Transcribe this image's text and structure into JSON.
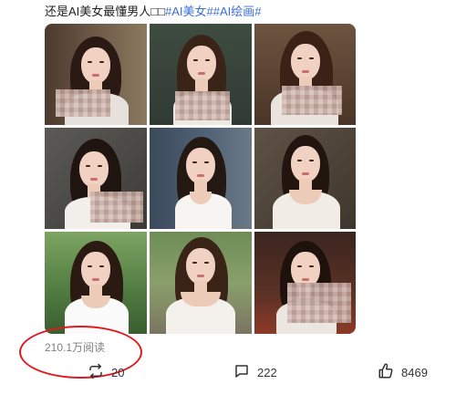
{
  "post": {
    "text": "还是AI美女最懂男人□□",
    "tags": [
      "#AI美女#",
      "#AI绘画#"
    ]
  },
  "stats": {
    "views": "210.1万阅读",
    "reposts": "20",
    "comments": "222",
    "likes": "8469"
  },
  "icons": [
    "repost-icon",
    "comment-icon",
    "like-icon"
  ],
  "colors": {
    "tag": "#3b6fd6",
    "highlight_circle": "#e0191f",
    "meta_text": "#808080"
  }
}
